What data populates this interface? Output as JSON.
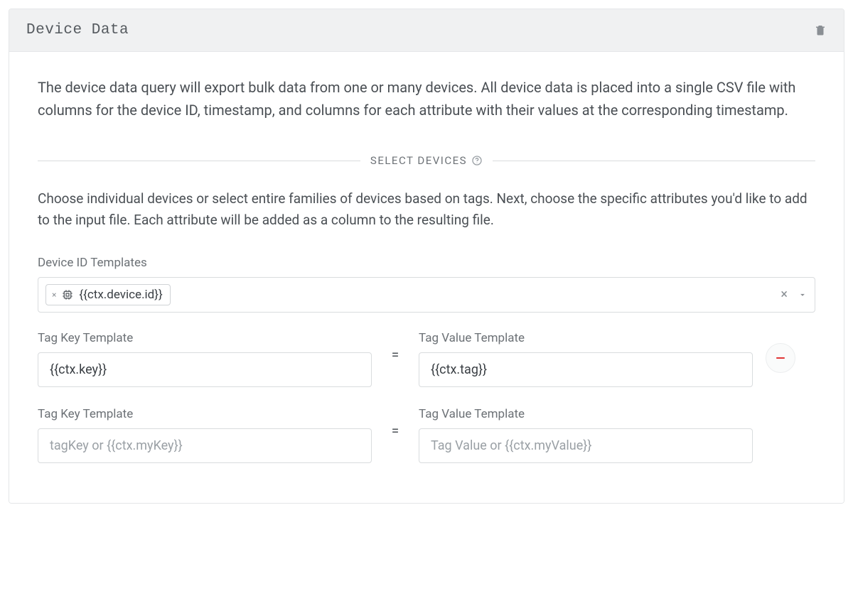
{
  "header": {
    "title": "Device Data"
  },
  "intro_text": "The device data query will export bulk data from one or many devices. All device data is placed into a single CSV file with columns for the device ID, timestamp, and columns for each attribute with their values at the corresponding timestamp.",
  "section": {
    "divider_label": "SELECT DEVICES",
    "description": "Choose individual devices or select entire families of devices based on tags. Next, choose the specific attributes you'd like to add to the input file. Each attribute will be added as a column to the resulting file."
  },
  "device_id_templates": {
    "label": "Device ID Templates",
    "chips": [
      {
        "text": "{{ctx.device.id}}"
      }
    ]
  },
  "tag_rows": [
    {
      "key_label": "Tag Key Template",
      "key_value": "{{ctx.key}}",
      "key_placeholder": "",
      "value_label": "Tag Value Template",
      "value_value": "{{ctx.tag}}",
      "value_placeholder": "",
      "removable": true
    },
    {
      "key_label": "Tag Key Template",
      "key_value": "",
      "key_placeholder": "tagKey or {{ctx.myKey}}",
      "value_label": "Tag Value Template",
      "value_value": "",
      "value_placeholder": "Tag Value or {{ctx.myValue}}",
      "removable": false
    }
  ],
  "symbols": {
    "equals": "="
  }
}
